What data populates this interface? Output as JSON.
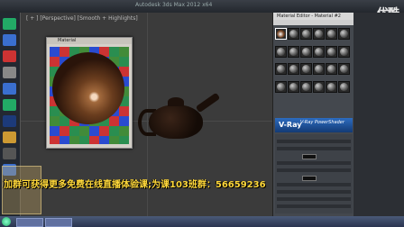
{
  "window": {
    "title": "Autodesk 3ds Max 2012 x64"
  },
  "watermark": "优酷",
  "viewport": {
    "label": "[ + ] [Perspective] [Smooth + Highlights]"
  },
  "preview": {
    "title": "Material"
  },
  "material_editor": {
    "title": "Material Editor - Material #2",
    "banner_logo": "V-Ray",
    "banner_name": "V-Ray PowerShader"
  },
  "promo": {
    "text": "加群可获得更多免费在线直播体验课;为课103班群：56659236"
  },
  "taskbar": {
    "clock": ""
  },
  "colors": {
    "accent_yellow": "#ffd83a",
    "vray_blue": "#2d6cc0"
  }
}
